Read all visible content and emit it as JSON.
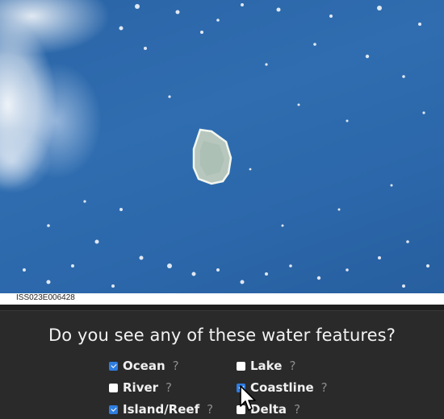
{
  "photo": {
    "caption": "ISS023E006428",
    "ocean_color": "#2b67aa",
    "island_color": "#b7c7bd"
  },
  "question": {
    "text": "Do you see any of these water features?"
  },
  "options": [
    {
      "label": "Ocean",
      "checked": true,
      "help": "?"
    },
    {
      "label": "Lake",
      "checked": false,
      "help": "?"
    },
    {
      "label": "River",
      "checked": false,
      "help": "?"
    },
    {
      "label": "Coastline",
      "checked": true,
      "help": "?"
    },
    {
      "label": "Island/Reef",
      "checked": true,
      "help": "?"
    },
    {
      "label": "Delta",
      "checked": false,
      "help": "?"
    }
  ],
  "colors": {
    "panel_bg": "#2a2a2a",
    "checkbox_checked": "#2f7de0",
    "help_icon": "#8c8c8c"
  }
}
